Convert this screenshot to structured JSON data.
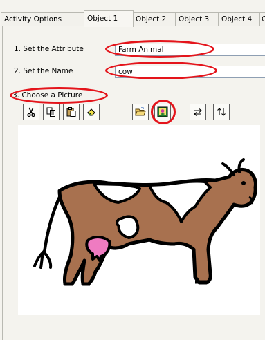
{
  "tabs": [
    {
      "label": "Activity Options"
    },
    {
      "label": "Object 1"
    },
    {
      "label": "Object 2"
    },
    {
      "label": "Object 3"
    },
    {
      "label": "Object 4"
    },
    {
      "label": "C"
    }
  ],
  "form": {
    "attribute_label": "1. Set the Attribute",
    "attribute_value": "Farm Animal",
    "name_label": "2. Set the Name",
    "name_value": "cow",
    "picture_label": "3. Choose a Picture"
  },
  "toolbar": {
    "buttons": [
      "scissors-icon",
      "copy-icon",
      "paste-icon",
      "eraser-icon",
      "open-folder-icon",
      "picture-icon",
      "swap-horizontal-icon",
      "swap-vertical-icon"
    ]
  },
  "colors": {
    "annotation": "#e4141b",
    "cow_body": "#a8714f",
    "udder": "#ef7bc1"
  }
}
